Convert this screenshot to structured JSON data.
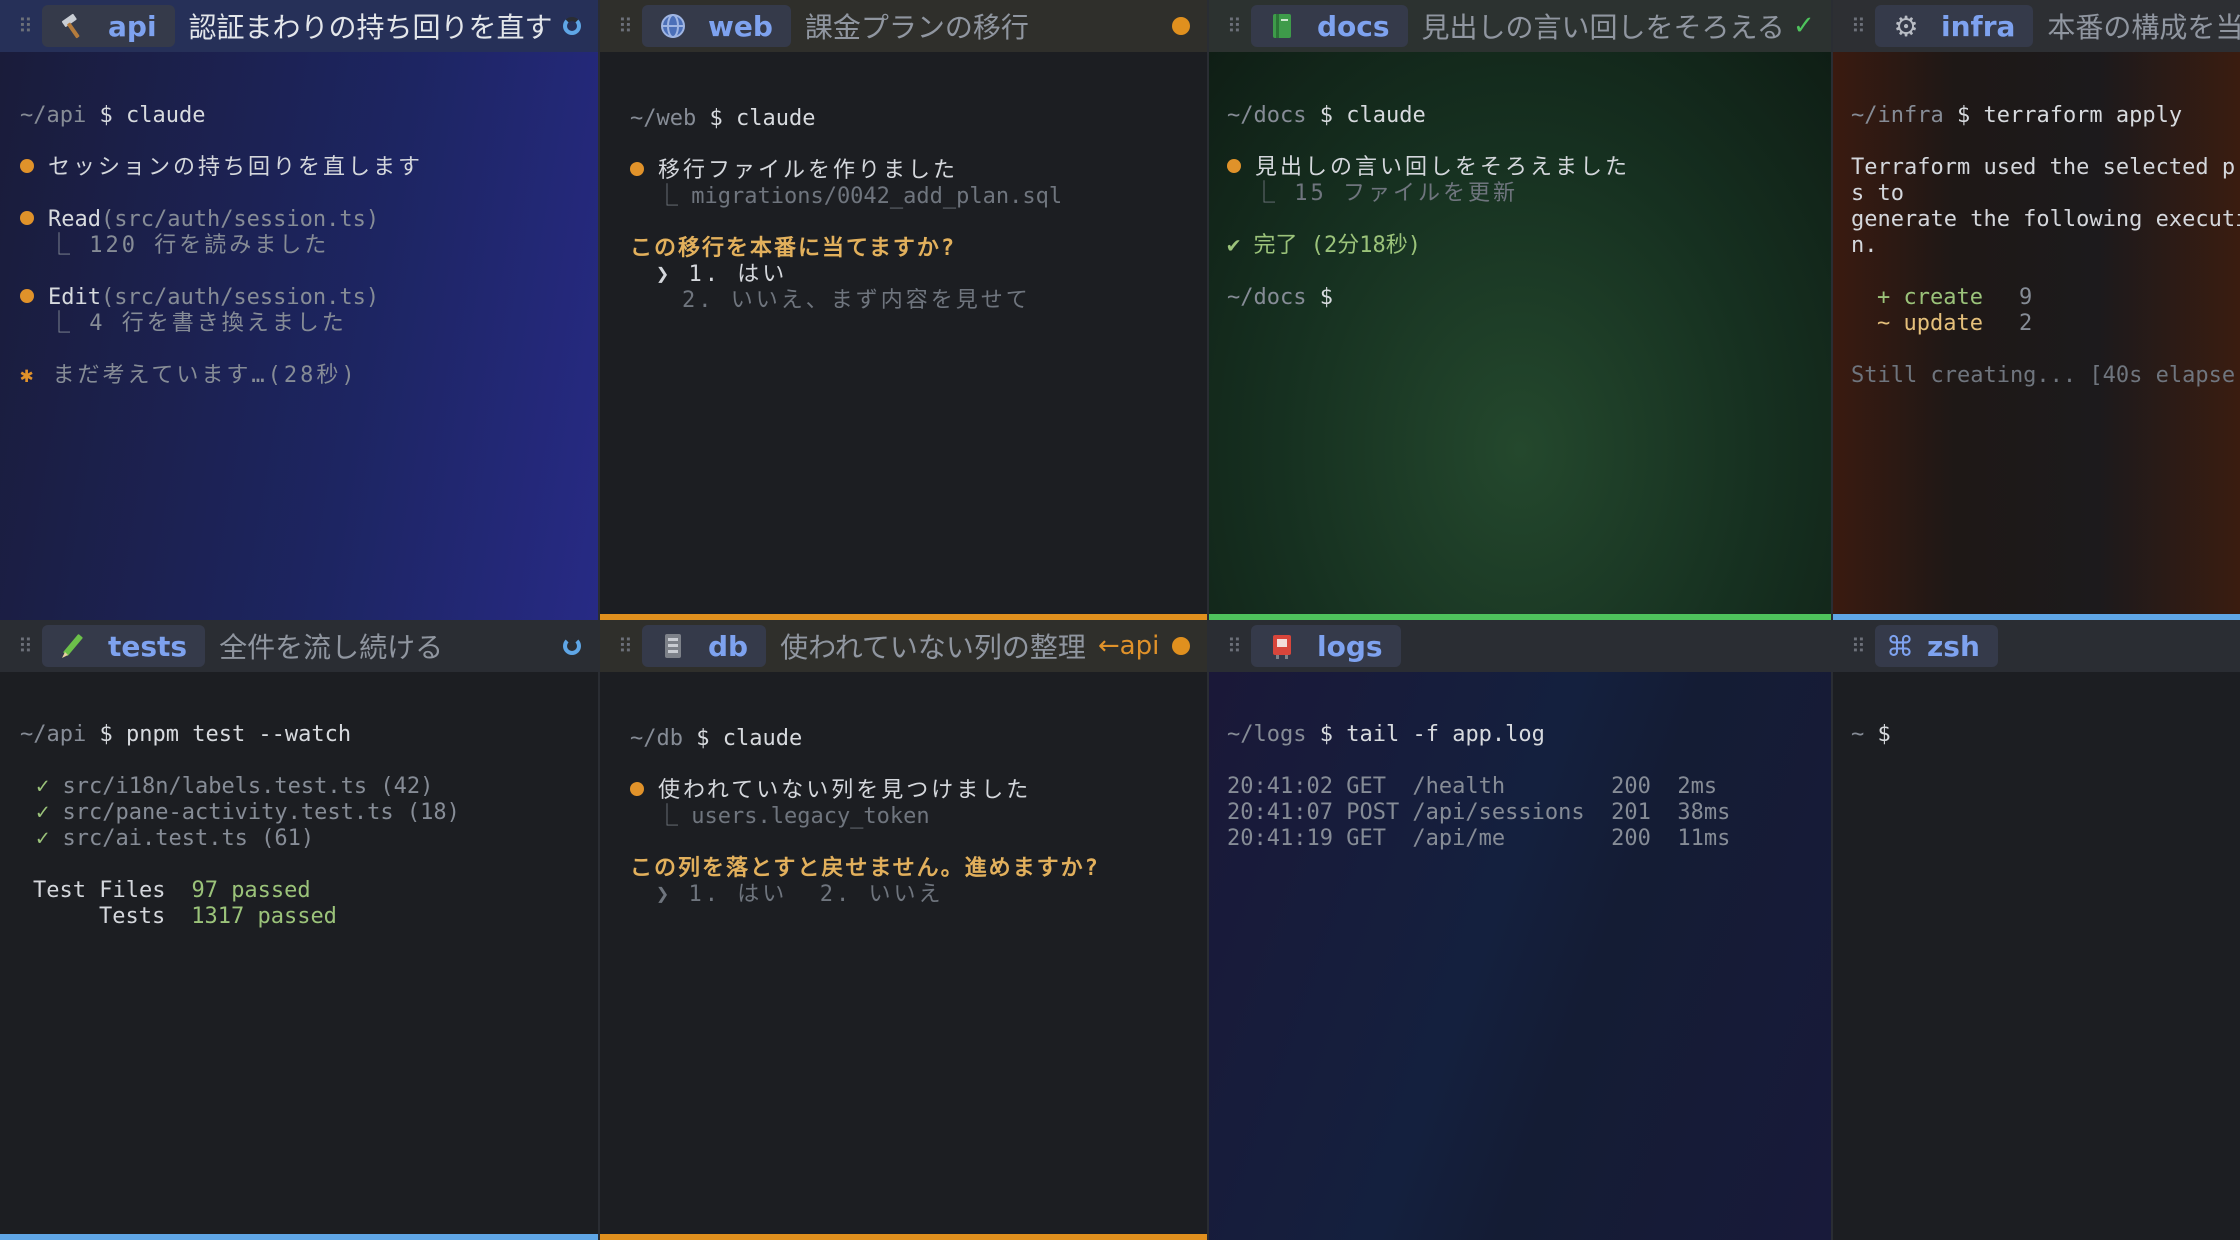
{
  "colors": {
    "accent_blue": "#7ea2ef",
    "status_orange": "#e0901e",
    "status_green": "#4ec35c",
    "bar_blue": "#5fa6e6"
  },
  "panes": {
    "api": {
      "icon": "hammer-icon",
      "name": "api",
      "title": "認証まわりの持ち回りを直す",
      "status": "running-spinner",
      "prompt_dir": "~/api",
      "prompt_sym": "$",
      "command": "claude",
      "l1": "セッションの持ち回りを直します",
      "l2_tool": "Read",
      "l2_arg": "(src/auth/session.ts)",
      "l2_sub": "⎿ 120 行を読みました",
      "l3_tool": "Edit",
      "l3_arg": "(src/auth/session.ts)",
      "l3_sub": "⎿ 4 行を書き換えました",
      "thinking_star": "✱",
      "thinking": "まだ考えています…(28秒)"
    },
    "web": {
      "icon": "globe-icon",
      "name": "web",
      "title": "課金プランの移行",
      "status": "needs-attention-dot",
      "prompt_dir": "~/web",
      "prompt_sym": "$",
      "command": "claude",
      "l1": "移行ファイルを作りました",
      "l1_sub": "⎿ migrations/0042_add_plan.sql",
      "question": "この移行を本番に当てますか?",
      "opt1": "❯ 1. はい",
      "opt2": "2. いいえ、まず内容を見せて"
    },
    "docs": {
      "icon": "book-icon",
      "name": "docs",
      "title": "見出しの言い回しをそろえる",
      "status": "done-check",
      "status_glyph": "✓",
      "prompt_dir": "~/docs",
      "prompt_sym": "$",
      "command": "claude",
      "l1": "見出しの言い回しをそろえました",
      "l1_sub": "⎿ 15 ファイルを更新",
      "done": "✔ 完了 (2分18秒)",
      "prompt2_dir": "~/docs",
      "prompt2_sym": "$"
    },
    "infra": {
      "icon": "gear-icon",
      "name": "infra",
      "title": "本番の構成を当て",
      "prompt_dir": "~/infra",
      "prompt_sym": "$",
      "command": "terraform apply",
      "t1": "Terraform used the selected p",
      "t2": "s to",
      "t3": "generate the following executi",
      "t4": "n.",
      "create_label": "+ create",
      "create_count": "9",
      "update_label": "~ update",
      "update_count": "2",
      "still": "Still creating... [40s elapse"
    },
    "tests": {
      "icon": "pencil-icon",
      "name": "tests",
      "title": "全件を流し続ける",
      "status": "running-spinner",
      "prompt_dir": "~/api",
      "prompt_sym": "$",
      "command": "pnpm test --watch",
      "files": [
        {
          "check": "✓",
          "text": "src/i18n/labels.test.ts (42)"
        },
        {
          "check": "✓",
          "text": "src/pane-activity.test.ts (18)"
        },
        {
          "check": "✓",
          "text": "src/ai.test.ts (61)"
        }
      ],
      "files_label": "Test Files",
      "files_value": "97 passed",
      "tests_label": "Tests",
      "tests_value": "1317 passed"
    },
    "db": {
      "icon": "database-icon",
      "name": "db",
      "title": "使われていない列の整理",
      "link": "←api",
      "status": "needs-attention-dot",
      "prompt_dir": "~/db",
      "prompt_sym": "$",
      "command": "claude",
      "l1": "使われていない列を見つけました",
      "l1_sub": "⎿ users.legacy_token",
      "question": "この列を落とすと戻せません。進めますか?",
      "opts": "❯ 1. はい  2. いいえ"
    },
    "logs": {
      "icon": "log-icon",
      "name": "logs",
      "prompt_dir": "~/logs",
      "prompt_sym": "$",
      "command": "tail -f app.log",
      "lines": [
        "20:41:02 GET  /health        200  2ms",
        "20:41:07 POST /api/sessions  201  38ms",
        "20:41:19 GET  /api/me        200  11ms"
      ]
    },
    "zsh": {
      "icon": "command-icon",
      "name": "zsh",
      "prompt_dir": "~",
      "prompt_sym": "$"
    }
  }
}
